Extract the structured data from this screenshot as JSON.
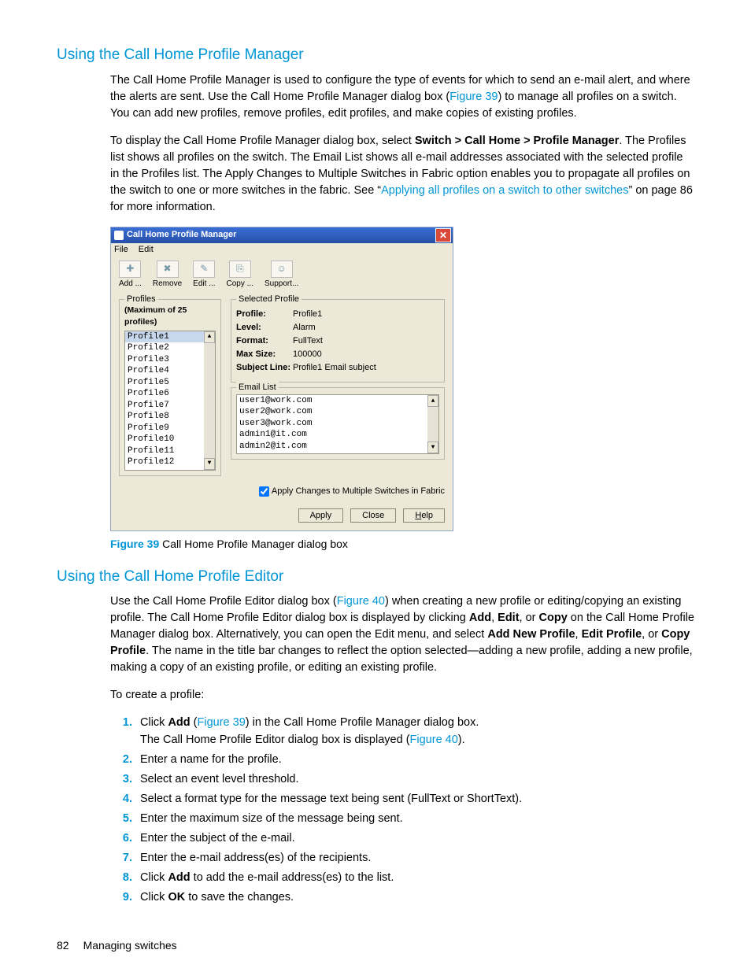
{
  "section1": {
    "heading": "Using the Call Home Profile Manager",
    "para1_a": "The Call Home Profile Manager is used to configure the type of events for which to send an e-mail alert, and where the alerts are sent. Use the Call Home Profile Manager dialog box (",
    "para1_link": "Figure 39",
    "para1_b": ") to manage all profiles on a switch. You can add new profiles, remove profiles, edit profiles, and make copies of existing profiles.",
    "para2_a": "To display the Call Home Profile Manager dialog box, select ",
    "para2_bold": "Switch > Call Home > Profile Manager",
    "para2_b": ". The Profiles list shows all profiles on the switch. The Email List shows all e-mail addresses associated with the selected profile in the Profiles list. The Apply Changes to Multiple Switches in Fabric option enables you to propagate all profiles on the switch to one or more switches in the fabric. See “",
    "para2_link": "Applying all profiles on a switch to other switches",
    "para2_c": "” on page 86 for more information."
  },
  "dialog": {
    "title": "Call Home Profile Manager",
    "menu": {
      "file": "File",
      "edit": "Edit"
    },
    "toolbar": {
      "add": {
        "label": "Add ...",
        "glyph": "✚"
      },
      "remove": {
        "label": "Remove",
        "glyph": "✖"
      },
      "edit": {
        "label": "Edit ...",
        "glyph": "✎"
      },
      "copy": {
        "label": "Copy ...",
        "glyph": "⎘"
      },
      "support": {
        "label": "Support...",
        "glyph": "☺"
      }
    },
    "profiles": {
      "legend": "Profiles",
      "max_note": "(Maximum of 25 profiles)",
      "items": [
        "Profile1",
        "Profile2",
        "Profile3",
        "Profile4",
        "Profile5",
        "Profile6",
        "Profile7",
        "Profile8",
        "Profile9",
        "Profile10",
        "Profile11",
        "Profile12"
      ],
      "selected_index": 0
    },
    "selected": {
      "legend": "Selected Profile",
      "profile_k": "Profile:",
      "profile_v": "Profile1",
      "level_k": "Level:",
      "level_v": "Alarm",
      "format_k": "Format:",
      "format_v": "FullText",
      "max_k": "Max Size:",
      "max_v": "100000",
      "subj_k": "Subject Line:",
      "subj_v": "Profile1 Email subject"
    },
    "email": {
      "legend": "Email List",
      "items": [
        "user1@work.com",
        "user2@work.com",
        "user3@work.com",
        "admin1@it.com",
        "admin2@it.com"
      ]
    },
    "apply_multi": "Apply Changes to Multiple Switches in Fabric",
    "buttons": {
      "apply": "Apply",
      "close": "Close",
      "help": "Help",
      "help_ul": "H"
    }
  },
  "figure39": {
    "label": "Figure 39",
    "caption": " Call Home Profile Manager dialog box"
  },
  "section2": {
    "heading": "Using the Call Home Profile Editor",
    "para1_a": "Use the Call Home Profile Editor dialog box (",
    "para1_link": "Figure 40",
    "para1_b": ") when creating a new profile or editing/copying an existing profile. The Call Home Profile Editor dialog box is displayed by clicking ",
    "para1_bold1": "Add",
    "para1_c": ", ",
    "para1_bold2": "Edit",
    "para1_d": ", or ",
    "para1_bold3": "Copy",
    "para1_e": " on the Call Home Profile Manager dialog box. Alternatively, you can open the Edit menu, and select ",
    "para1_bold4": "Add New Profile",
    "para1_f": ", ",
    "para1_bold5": "Edit Profile",
    "para1_g": ", or ",
    "para1_bold6": "Copy Profile",
    "para1_h": ". The name in the title bar changes to reflect the option selected—adding a new profile, adding a new profile, making a copy of an existing profile, or editing an existing profile.",
    "para2": "To create a profile:",
    "steps": {
      "s1a": "Click ",
      "s1b": "Add",
      "s1c": " (",
      "s1link": "Figure 39",
      "s1d": ") in the Call Home Profile Manager dialog box.",
      "s1e": "The Call Home Profile Editor dialog box is displayed (",
      "s1link2": "Figure 40",
      "s1f": ").",
      "s2": "Enter a name for the profile.",
      "s3": "Select an event level threshold.",
      "s4": "Select a format type for the message text being sent (FullText or ShortText).",
      "s5": "Enter the maximum size of the message being sent.",
      "s6": "Enter the subject of the e-mail.",
      "s7": "Enter the e-mail address(es) of the recipients.",
      "s8a": "Click ",
      "s8b": "Add",
      "s8c": " to add the e-mail address(es) to the list.",
      "s9a": "Click ",
      "s9b": "OK",
      "s9c": " to save the changes."
    }
  },
  "footer": {
    "page": "82",
    "chapter": "Managing switches"
  }
}
